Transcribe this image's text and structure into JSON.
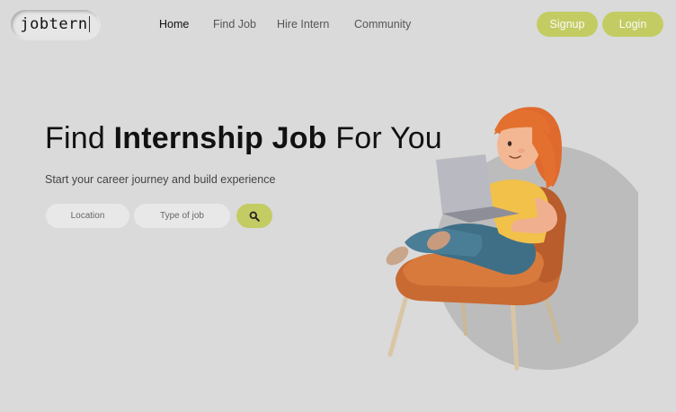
{
  "header": {
    "logo_text": "jobtern",
    "nav": [
      "Home",
      "Find Job",
      "Hire Intern",
      "Community"
    ],
    "signup_label": "Signup",
    "login_label": "Login"
  },
  "hero": {
    "title_pre": "Find",
    "title_bold": "Internship Job",
    "title_post": "For You",
    "subtitle": "Start your career journey and build experience",
    "location_placeholder": "Location",
    "job_type_placeholder": "Type of job"
  },
  "icons": {
    "search_button": "search-icon",
    "illustration": "girl-with-laptop-in-chair"
  },
  "colors": {
    "background": "#dadada",
    "accent": "#c3cc62",
    "input_bg": "#e8e8e8",
    "circle": "#bcbcbc"
  }
}
